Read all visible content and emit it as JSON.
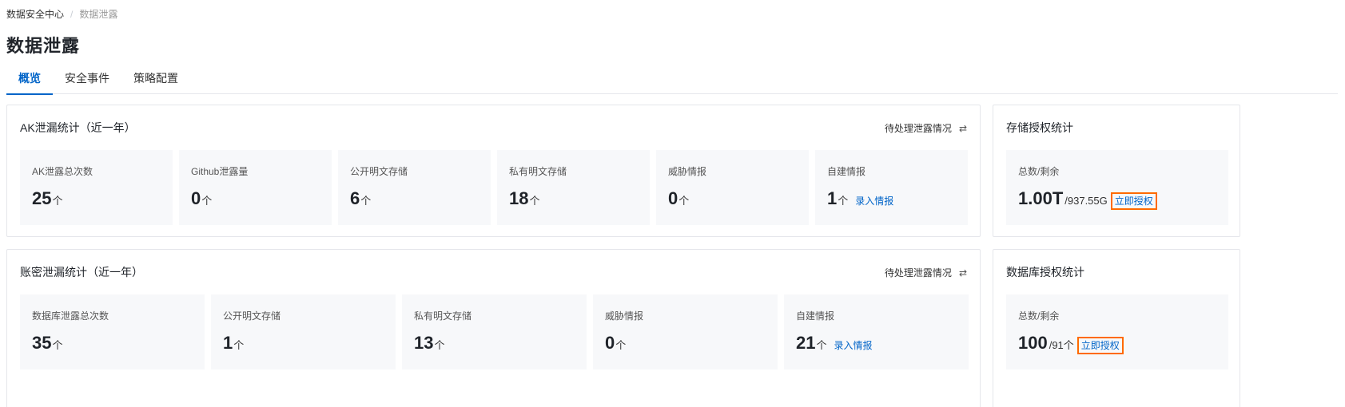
{
  "breadcrumb": {
    "parent": "数据安全中心",
    "separator": "/",
    "current": "数据泄露"
  },
  "page_title": "数据泄露",
  "tabs": [
    {
      "label": "概览",
      "active": true
    },
    {
      "label": "安全事件",
      "active": false
    },
    {
      "label": "策略配置",
      "active": false
    }
  ],
  "ak_card": {
    "title": "AK泄漏统计（近一年）",
    "action_label": "待处理泄露情况",
    "action_icon": "swap-icon",
    "stats": [
      {
        "label": "AK泄露总次数",
        "value": "25",
        "unit": "个"
      },
      {
        "label": "Github泄露量",
        "value": "0",
        "unit": "个"
      },
      {
        "label": "公开明文存储",
        "value": "6",
        "unit": "个"
      },
      {
        "label": "私有明文存储",
        "value": "18",
        "unit": "个"
      },
      {
        "label": "威胁情报",
        "value": "0",
        "unit": "个"
      },
      {
        "label": "自建情报",
        "value": "1",
        "unit": "个",
        "link": "录入情报"
      }
    ]
  },
  "storage_card": {
    "title": "存储授权统计",
    "label": "总数/剩余",
    "total": "1.00T",
    "remaining": "/937.55G",
    "link": "立即授权"
  },
  "account_card": {
    "title": "账密泄漏统计（近一年）",
    "action_label": "待处理泄露情况",
    "action_icon": "swap-icon",
    "stats": [
      {
        "label": "数据库泄露总次数",
        "value": "35",
        "unit": "个"
      },
      {
        "label": "公开明文存储",
        "value": "1",
        "unit": "个"
      },
      {
        "label": "私有明文存储",
        "value": "13",
        "unit": "个"
      },
      {
        "label": "威胁情报",
        "value": "0",
        "unit": "个"
      },
      {
        "label": "自建情报",
        "value": "21",
        "unit": "个",
        "link": "录入情报"
      }
    ]
  },
  "db_card": {
    "title": "数据库授权统计",
    "label": "总数/剩余",
    "total": "100",
    "remaining": "/91个",
    "link": "立即授权"
  },
  "colors": {
    "accent": "#0064c8",
    "highlight_border": "#ff6a00",
    "stat_bg": "#f7f8fa"
  }
}
